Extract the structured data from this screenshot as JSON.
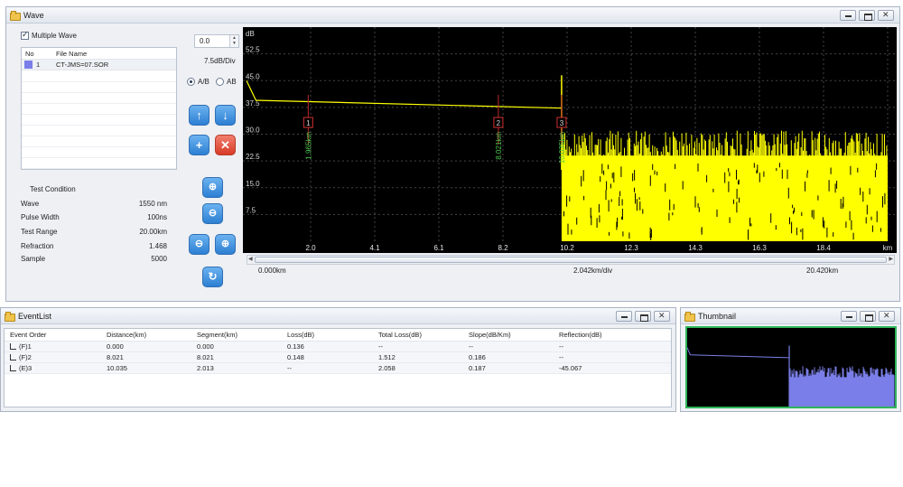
{
  "wave_window": {
    "title": "Wave",
    "multiple_wave": {
      "label": "Multiple Wave",
      "checked": true
    },
    "file_table": {
      "headers": [
        "No",
        "File Name"
      ],
      "rows": [
        {
          "no": "1",
          "file_name": "CT-JMS=07.SOR",
          "color": "#7a7ee8"
        }
      ]
    },
    "test_condition": {
      "title": "Test Condition",
      "items": [
        {
          "label": "Wave",
          "value": "1550 nm"
        },
        {
          "label": "Pulse Width",
          "value": "100ns"
        },
        {
          "label": "Test Range",
          "value": "20.00km"
        },
        {
          "label": "Refraction",
          "value": "1.468"
        },
        {
          "label": "Sample",
          "value": "5000"
        }
      ]
    },
    "offset_value": "0.0",
    "db_per_div": "7.5dB/Div",
    "radio": {
      "a_slash_b": "A/B",
      "ab": "AB",
      "selected": "A/B"
    },
    "icons": [
      "arrow-up-icon",
      "arrow-down-icon",
      "add-icon",
      "delete-icon",
      "zoom-in-icon",
      "zoom-out-icon",
      "zoom-x-icon",
      "zoom-y-icon",
      "reset-icon"
    ],
    "x_start": "0.000km",
    "x_div": "2.042km/div",
    "x_end": "20.420km"
  },
  "chart_data": {
    "type": "line",
    "y_unit": "dB",
    "y_ticks": [
      "52.5",
      "45.0",
      "37.5",
      "30.0",
      "22.5",
      "15.0",
      "7.5"
    ],
    "ylim": [
      0,
      60
    ],
    "x_ticks": [
      "2.0",
      "4.1",
      "6.1",
      "8.2",
      "10.2",
      "12.3",
      "14.3",
      "16.3",
      "18.4",
      "km"
    ],
    "xlim": [
      0,
      20.42
    ],
    "trace_color": "#ffff00",
    "background": "#000000",
    "trace": {
      "x": [
        0,
        0.3,
        10.035
      ],
      "y": [
        45,
        39.5,
        37.3
      ]
    },
    "spike": {
      "x": 10.035,
      "y_top": 46.5
    },
    "noise_floor": {
      "x_from": 10.035,
      "x_to": 20.42,
      "y_min": 0,
      "y_max": 31
    },
    "markers": [
      {
        "id": "1",
        "x": 1.965,
        "label": "1.965km"
      },
      {
        "id": "2",
        "x": 8.021,
        "label": "8.021km"
      },
      {
        "id": "3",
        "x": 10.035,
        "label": "10.035km"
      }
    ]
  },
  "event_window": {
    "title": "EventList",
    "headers": [
      "Event Order",
      "Distance(km)",
      "Segment(km)",
      "Loss(dB)",
      "Total Loss(dB)",
      "Slope(dB/Km)",
      "Reflection(dB)"
    ],
    "rows": [
      [
        "(F)1",
        "0.000",
        "0.000",
        "0.136",
        "--",
        "--",
        "--"
      ],
      [
        "(F)2",
        "8.021",
        "8.021",
        "0.148",
        "1.512",
        "0.186",
        "--"
      ],
      [
        "(E)3",
        "10.035",
        "2.013",
        "--",
        "2.058",
        "0.187",
        "-45.067"
      ]
    ]
  },
  "thumb_window": {
    "title": "Thumbnail",
    "trace_color": "#7a7ee8"
  }
}
